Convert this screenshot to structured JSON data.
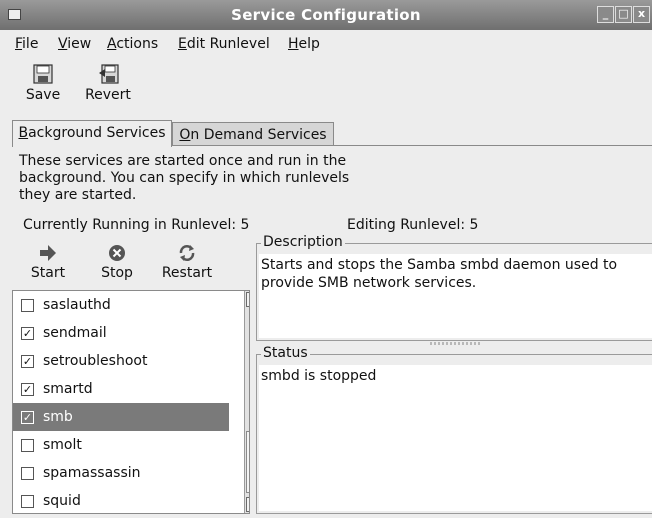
{
  "window": {
    "title": "Service Configuration",
    "buttons": [
      "_",
      "□",
      "x"
    ]
  },
  "menubar": {
    "items": [
      {
        "label": "File",
        "mnemonic": "F",
        "rest": "ile"
      },
      {
        "label": "View",
        "mnemonic": "V",
        "rest": "iew"
      },
      {
        "label": "Actions",
        "mnemonic": "A",
        "rest": "ctions"
      },
      {
        "label": "Edit Runlevel",
        "mnemonic": "E",
        "rest": "dit Runlevel"
      },
      {
        "label": "Help",
        "mnemonic": "H",
        "rest": "elp"
      }
    ]
  },
  "toolbar": {
    "save_label": "Save",
    "save_icon": "floppy-disk-icon",
    "revert_label": "Revert",
    "revert_icon": "revert-icon"
  },
  "tabs": [
    {
      "label": "Background Services",
      "mnemonic": "B",
      "rest": "ackground Services",
      "active": true
    },
    {
      "label": "On Demand Services",
      "mnemonic": "O",
      "rest": "n Demand Services",
      "active": false
    }
  ],
  "intro_text": "These services are started once and run in the background. You can specify in which runlevels they are started.",
  "runlevel": {
    "running_label": "Currently Running in Runlevel: 5",
    "editing_label": "Editing Runlevel: 5"
  },
  "service_actions": {
    "start_label": "Start",
    "stop_label": "Stop",
    "restart_label": "Restart"
  },
  "services": [
    {
      "name": "saslauthd",
      "checked": false,
      "selected": false
    },
    {
      "name": "sendmail",
      "checked": true,
      "selected": false
    },
    {
      "name": "setroubleshoot",
      "checked": true,
      "selected": false
    },
    {
      "name": "smartd",
      "checked": true,
      "selected": false
    },
    {
      "name": "smb",
      "checked": true,
      "selected": true
    },
    {
      "name": "smolt",
      "checked": false,
      "selected": false
    },
    {
      "name": "spamassassin",
      "checked": false,
      "selected": false
    },
    {
      "name": "squid",
      "checked": false,
      "selected": false
    }
  ],
  "description": {
    "legend": "Description",
    "text": "Starts and stops the Samba smbd daemon used to provide SMB network services."
  },
  "status": {
    "legend": "Status",
    "text": "smbd is stopped"
  },
  "colors": {
    "selection": "#7a7a7a",
    "titlebar": "#7d7d7d",
    "window": "#ededed"
  }
}
